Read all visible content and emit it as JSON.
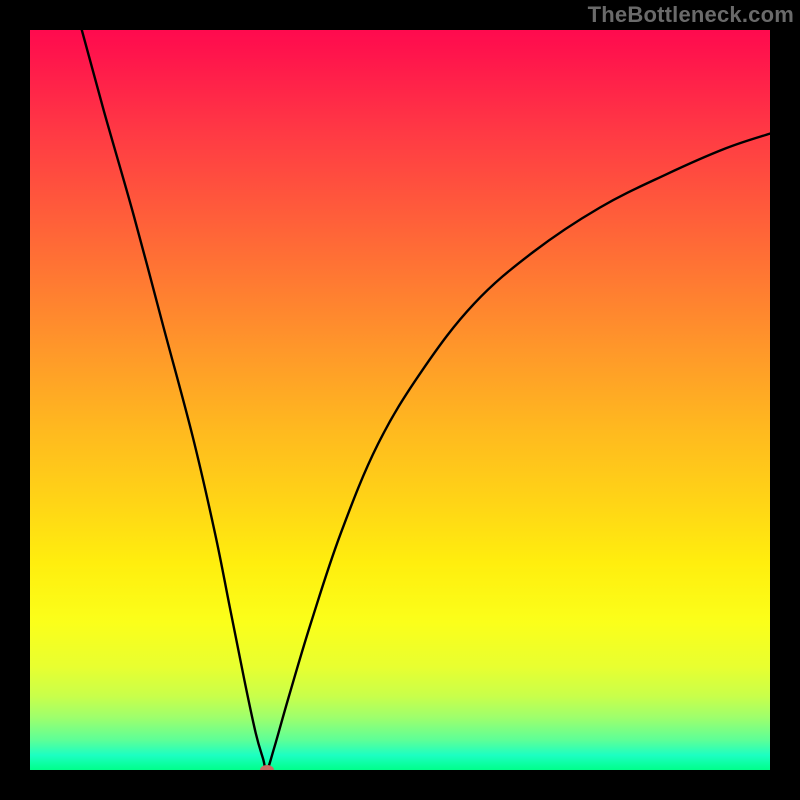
{
  "watermark": "TheBottleneck.com",
  "colors": {
    "black": "#000000",
    "curve": "#000000",
    "dot": "#c76b63"
  },
  "chart_data": {
    "type": "line",
    "title": "",
    "xlabel": "",
    "ylabel": "",
    "xlim": [
      0,
      100
    ],
    "ylim": [
      0,
      100
    ],
    "grid": false,
    "series": [
      {
        "name": "left-branch",
        "x": [
          7,
          10,
          14,
          18,
          22,
          25,
          27,
          29,
          30.5,
          31.5,
          32
        ],
        "y": [
          100,
          89,
          75,
          60,
          45,
          32,
          22,
          12,
          5,
          1.5,
          0
        ]
      },
      {
        "name": "right-branch",
        "x": [
          32,
          33,
          35,
          38,
          42,
          47,
          53,
          60,
          68,
          77,
          86,
          94,
          100
        ],
        "y": [
          0,
          3,
          10,
          20,
          32,
          44,
          54,
          63,
          70,
          76,
          80.5,
          84,
          86
        ]
      }
    ],
    "minimum_point": {
      "x": 32,
      "y": 0
    }
  }
}
